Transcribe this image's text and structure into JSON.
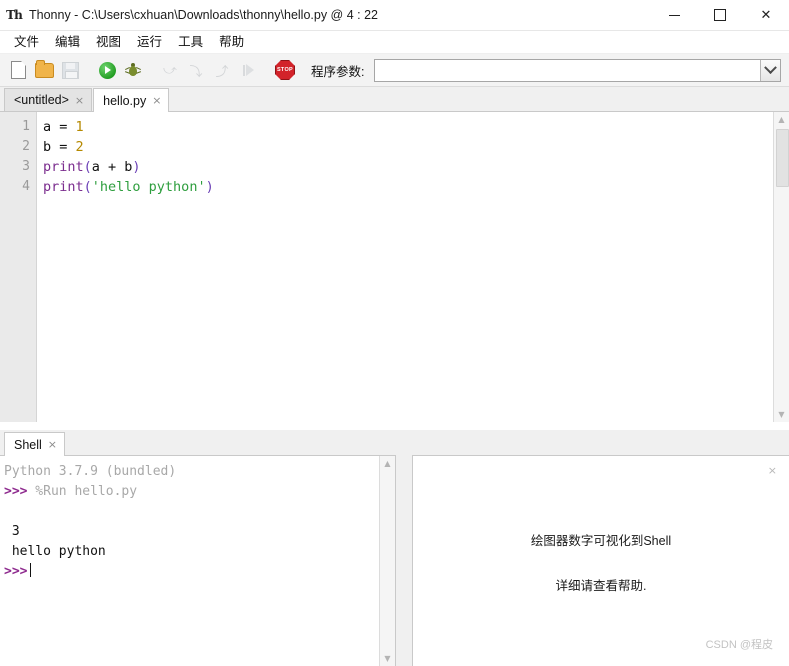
{
  "window": {
    "app_name": "Thonny",
    "icon": "thonny-logo-icon",
    "title": "Thonny  -  C:\\Users\\cxhuan\\Downloads\\thonny\\hello.py  @  4 : 22",
    "controls": {
      "minimize": "minimize-icon",
      "maximize": "maximize-icon",
      "close": "✕"
    }
  },
  "menubar": {
    "items": [
      {
        "label": "文件",
        "name": "menu-file"
      },
      {
        "label": "编辑",
        "name": "menu-edit"
      },
      {
        "label": "视图",
        "name": "menu-view"
      },
      {
        "label": "运行",
        "name": "menu-run"
      },
      {
        "label": "工具",
        "name": "menu-tools"
      },
      {
        "label": "帮助",
        "name": "menu-help"
      }
    ]
  },
  "toolbar": {
    "buttons": [
      {
        "icon": "new-file-icon",
        "enabled": true
      },
      {
        "icon": "open-folder-icon",
        "enabled": true
      },
      {
        "icon": "save-icon",
        "enabled": false
      },
      {
        "icon": "run-icon",
        "enabled": true
      },
      {
        "icon": "debug-bug-icon",
        "enabled": true
      },
      {
        "icon": "step-over-icon",
        "enabled": false
      },
      {
        "icon": "step-into-icon",
        "enabled": false
      },
      {
        "icon": "step-out-icon",
        "enabled": false
      },
      {
        "icon": "resume-icon",
        "enabled": false
      },
      {
        "icon": "stop-icon",
        "enabled": true
      }
    ],
    "stop_label": "STOP",
    "args_label": "程序参数:",
    "args_value": "",
    "args_placeholder": "",
    "args_dropdown_icon": "chevron-down-icon"
  },
  "editor": {
    "tabs": [
      {
        "label": "<untitled>",
        "active": false,
        "close": "×"
      },
      {
        "label": "hello.py",
        "active": true,
        "close": "×"
      }
    ],
    "line_numbers": [
      "1",
      "2",
      "3",
      "4"
    ],
    "lines": [
      [
        {
          "t": "a = ",
          "c": "plain"
        },
        {
          "t": "1",
          "c": "num"
        }
      ],
      [
        {
          "t": "b = ",
          "c": "plain"
        },
        {
          "t": "2",
          "c": "num"
        }
      ],
      [
        {
          "t": "print",
          "c": "fn"
        },
        {
          "t": "(",
          "c": "paren"
        },
        {
          "t": "a + b",
          "c": "plain"
        },
        {
          "t": ")",
          "c": "paren"
        }
      ],
      [
        {
          "t": "print",
          "c": "fn"
        },
        {
          "t": "(",
          "c": "paren"
        },
        {
          "t": "'hello python'",
          "c": "str"
        },
        {
          "t": ")",
          "c": "paren"
        }
      ]
    ],
    "scrollbar": {
      "up": "▲",
      "down": "▼"
    }
  },
  "shell": {
    "tab": {
      "label": "Shell",
      "close": "×"
    },
    "lines": [
      [
        {
          "t": "Python 3.7.9 (bundled)",
          "c": "dim"
        }
      ],
      [
        {
          "t": ">>>",
          "c": "prompt"
        },
        {
          "t": " %Run hello.py",
          "c": "dim"
        }
      ],
      [
        {
          "t": "",
          "c": "out"
        }
      ],
      [
        {
          "t": " 3",
          "c": "out"
        }
      ],
      [
        {
          "t": " hello python",
          "c": "out"
        }
      ],
      [
        {
          "t": ">>>",
          "c": "prompt"
        }
      ]
    ],
    "scrollbar": {
      "up": "▲",
      "down": "▼"
    }
  },
  "assistant_panel": {
    "close": "×",
    "line1": "绘图器数字可视化到Shell",
    "line2": "详细请查看帮助."
  },
  "watermark": "CSDN @程皮",
  "colors": {
    "accent_purple": "#8e2a8e",
    "run_green": "#1f9b1f",
    "stop_red": "#d2232a",
    "string_green": "#2e9e3e",
    "number_gold": "#b58900",
    "function_purple": "#7b2d8e"
  }
}
